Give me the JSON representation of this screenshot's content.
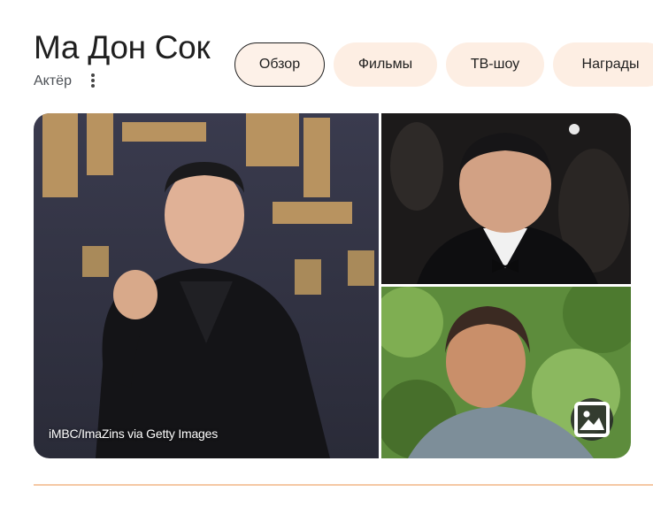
{
  "knowledge_panel": {
    "title": "Ма Дон Сок",
    "subtitle": "Актёр",
    "more_icon": "more-vert-icon",
    "tabs": [
      {
        "label": "Обзор",
        "active": true
      },
      {
        "label": "Фильмы",
        "active": false
      },
      {
        "label": "ТВ-шоу",
        "active": false
      },
      {
        "label": "Награды",
        "active": false
      }
    ],
    "images": {
      "credit": "iMBC/ImaZins via Getty Images",
      "more_images_icon": "image-icon"
    }
  },
  "colors": {
    "chip_bg": "#fdeee3",
    "divider": "#f5c8a4",
    "text": "#1f1f1f"
  }
}
